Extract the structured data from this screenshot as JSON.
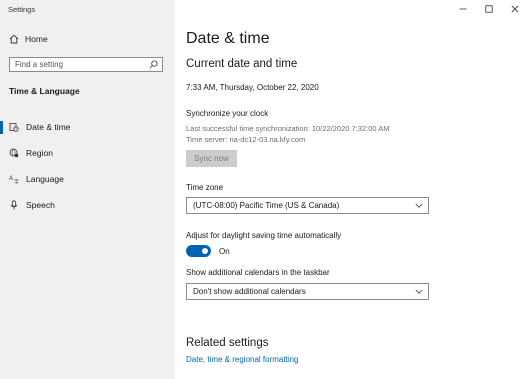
{
  "window": {
    "title": "Settings"
  },
  "sidebar": {
    "home_label": "Home",
    "search_placeholder": "Find a setting",
    "section_title": "Time & Language",
    "items": [
      {
        "label": "Date & time",
        "icon": "calendar-clock-icon",
        "active": true
      },
      {
        "label": "Region",
        "icon": "globe-gear-icon",
        "active": false
      },
      {
        "label": "Language",
        "icon": "language-icon",
        "active": false
      },
      {
        "label": "Speech",
        "icon": "microphone-icon",
        "active": false
      }
    ]
  },
  "main": {
    "page_title": "Date & time",
    "current_heading": "Current date and time",
    "current_value": "7:33 AM, Thursday, October 22, 2020",
    "sync": {
      "heading": "Synchronize your clock",
      "last_sync": "Last successful time synchronization: 10/22/2020 7:32:00 AM",
      "server": "Time server: na-dc12-03.na.kfy.com",
      "button": "Sync now"
    },
    "timezone": {
      "label": "Time zone",
      "value": "(UTC-08:00) Pacific Time (US & Canada)"
    },
    "dst": {
      "label": "Adjust for daylight saving time automatically",
      "state": "On"
    },
    "calendars": {
      "label": "Show additional calendars in the taskbar",
      "value": "Don't show additional calendars"
    },
    "related": {
      "heading": "Related settings",
      "link": "Date, time & regional formatting"
    }
  },
  "colors": {
    "accent": "#0063b1",
    "link": "#0066b4",
    "sidebar_bg": "#f0f0f0"
  }
}
